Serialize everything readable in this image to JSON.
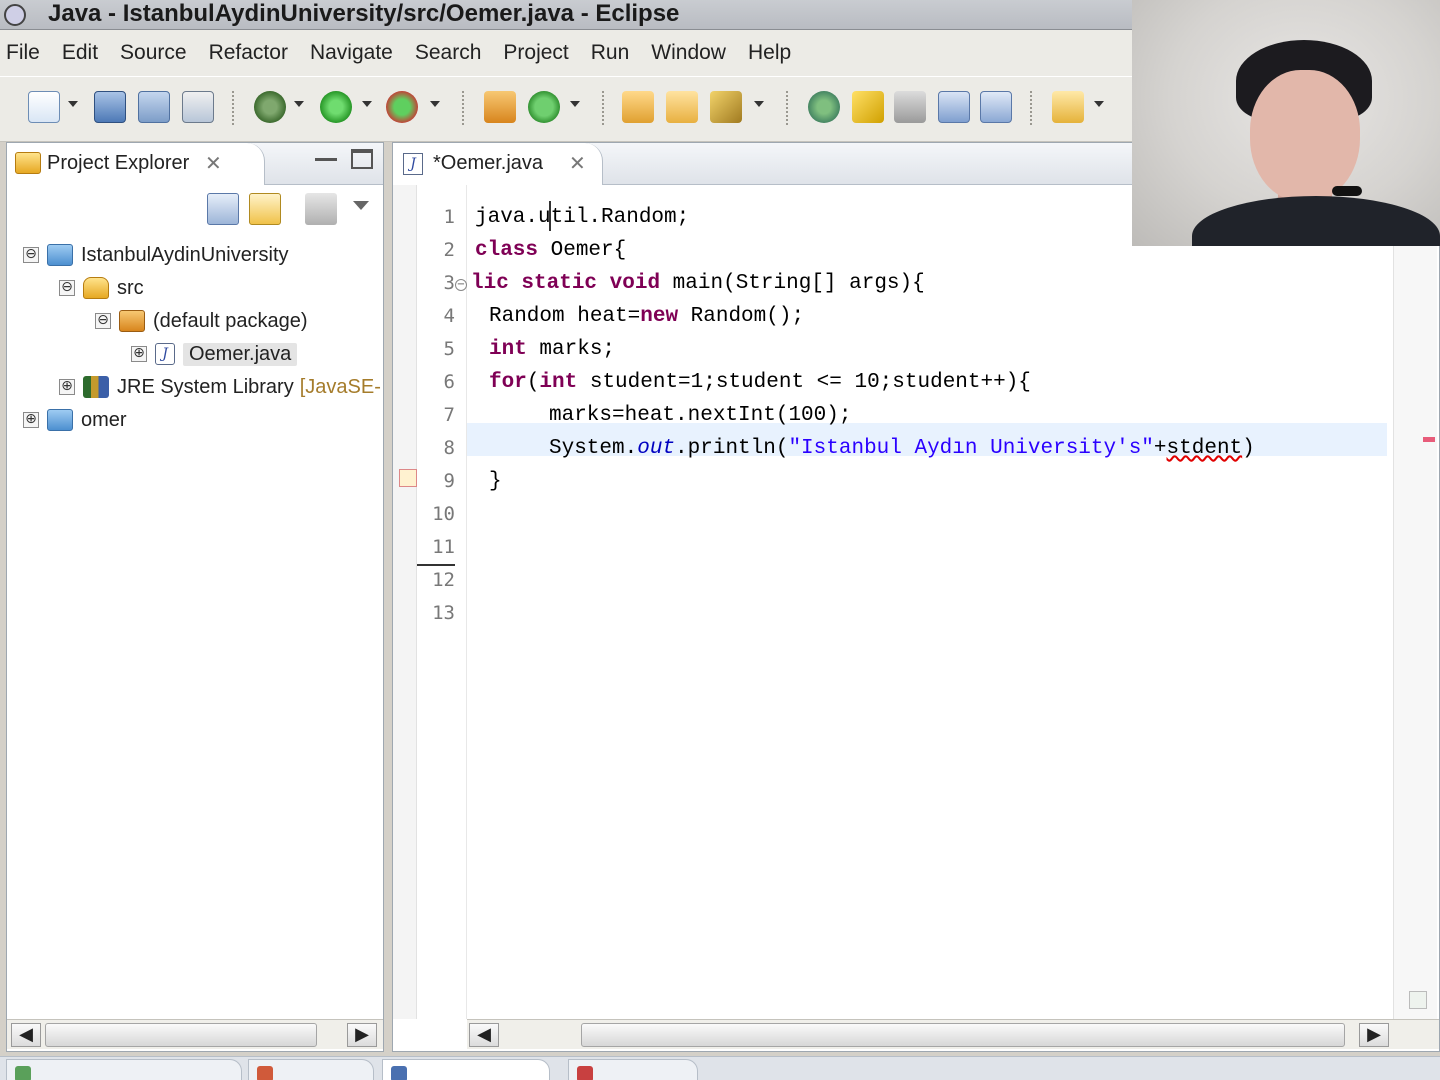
{
  "window": {
    "title": "Java - IstanbulAydinUniversity/src/Oemer.java - Eclipse"
  },
  "menu": [
    "File",
    "Edit",
    "Source",
    "Refactor",
    "Navigate",
    "Search",
    "Project",
    "Run",
    "Window",
    "Help"
  ],
  "toolbar": {
    "icons": [
      "new-wizard-icon",
      "save-icon",
      "save-all-icon",
      "print-icon",
      "debug-icon",
      "run-icon",
      "external-tools-icon",
      "new-java-package-icon",
      "new-java-class-icon",
      "open-type-icon",
      "open-task-icon",
      "search-icon",
      "toggle-mark-occurrences-icon",
      "toggle-highlight-icon",
      "toggle-block-selection-icon",
      "show-whitespace-icon",
      "next-annotation-icon"
    ]
  },
  "explorer": {
    "tab_label": "Project Explorer",
    "tree": [
      {
        "label": "IstanbulAydinUniversity",
        "icon": "project-folder-icon",
        "expander": "⊖"
      },
      {
        "label": "src",
        "icon": "source-folder-icon",
        "expander": "⊖"
      },
      {
        "label": "(default package)",
        "icon": "package-icon",
        "expander": "⊖"
      },
      {
        "label": "Oemer.java",
        "icon": "java-file-icon",
        "expander": "⊕"
      },
      {
        "label": "JRE System Library",
        "decoration": "[JavaSE-",
        "icon": "library-icon",
        "expander": "⊕"
      },
      {
        "label": "omer",
        "icon": "project-folder-icon",
        "expander": "⊕"
      }
    ]
  },
  "editor": {
    "tab_label": "*Oemer.java",
    "line_numbers": [
      "1",
      "2",
      "3",
      "4",
      "5",
      "6",
      "7",
      "8",
      "9",
      "10",
      "11",
      "12",
      "13"
    ],
    "code": {
      "line1": "java.util.Random;",
      "line2_kw": "class",
      "line2_rest": " Oemer{",
      "line3_a": "lic ",
      "line3_kw1": "static",
      "line3_sp": " ",
      "line3_kw2": "void",
      "line3_rest": " main(String[] args){",
      "line4_a": "Random heat=",
      "line4_kw": "new",
      "line4_rest": " Random();",
      "line5_kw": "int",
      "line5_rest": " marks;",
      "line6_kw1": "for",
      "line6_a": "(",
      "line6_kw2": "int",
      "line6_rest": " student=1;student <= 10;student++){",
      "line7": "marks=heat.nextInt(100);",
      "line8_a": "System.",
      "line8_field": "out",
      "line8_b": ".println(",
      "line8_str": "\"Istanbul Aydın University's\"",
      "line8_c": "+",
      "line8_err": "stdent",
      "line8_d": ")",
      "line9": "}"
    }
  },
  "colors": {
    "keyword": "#7f0055",
    "string": "#2a00ff",
    "field": "#0000c0",
    "error": "#e00000",
    "current_line": "#e8f2fe"
  }
}
